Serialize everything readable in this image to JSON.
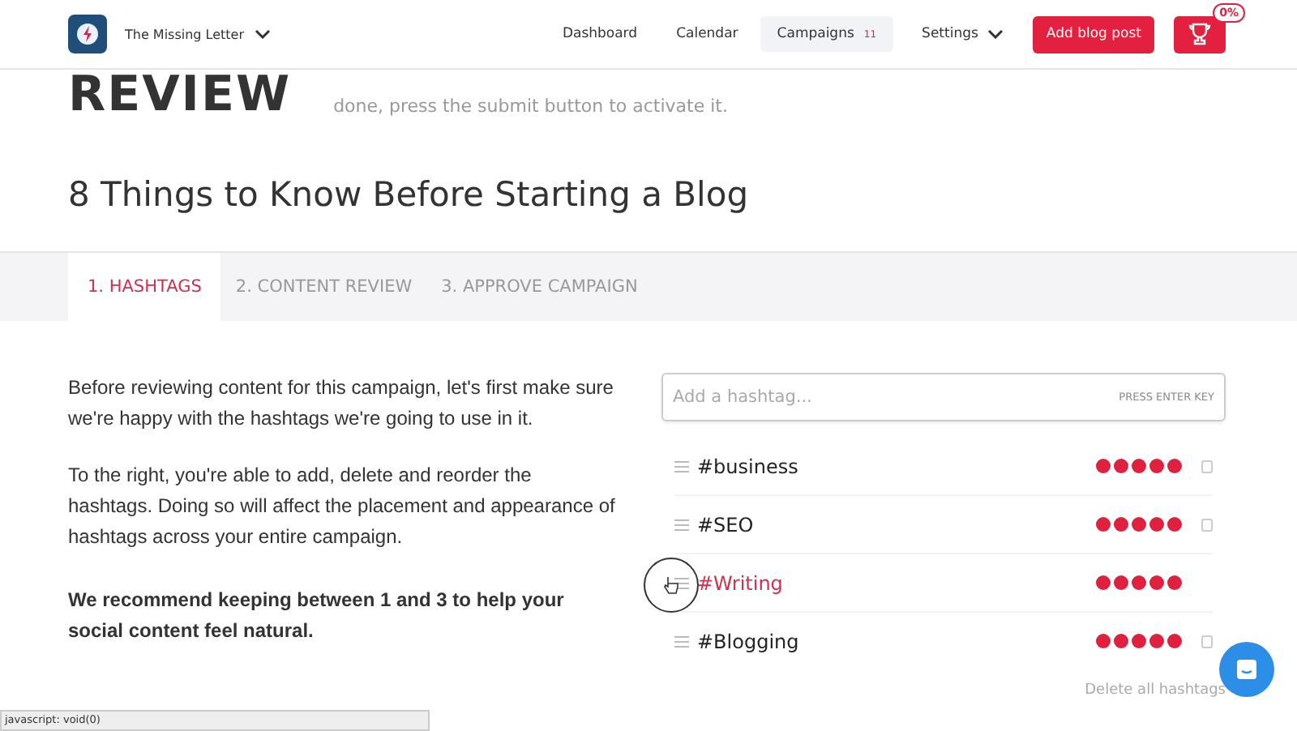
{
  "header": {
    "brand": "The Missing Letter",
    "nav": [
      {
        "label": "Dashboard",
        "selected": false
      },
      {
        "label": "Calendar",
        "selected": false
      },
      {
        "label": "Campaigns",
        "selected": true,
        "badge": "11"
      }
    ],
    "settings": "Settings",
    "add_button": "Add blog post",
    "progress_badge": "0%"
  },
  "page": {
    "heading": "REVIEW",
    "intro": "done, press the submit button to activate it.",
    "title": "8 Things to Know Before Starting a Blog"
  },
  "tabs": [
    {
      "label": "1. HASHTAGS",
      "selected": true
    },
    {
      "label": "2. CONTENT REVIEW",
      "selected": false
    },
    {
      "label": "3. APPROVE CAMPAIGN",
      "selected": false
    }
  ],
  "paragraphs": [
    {
      "text": "Before reviewing content for this campaign, let's first make sure we're happy with the hashtags we're going to use in it.",
      "bold": false
    },
    {
      "text": "To the right, you're able to add, delete and reorder the hashtags. Doing so will affect the placement and appearance of hashtags across your entire campaign.",
      "bold": false
    },
    {
      "text": "We recommend keeping between 1 and 3 to help your social content feel natural.",
      "bold": true
    }
  ],
  "hashtag_input": {
    "placeholder": "Add a hashtag...",
    "hint": "PRESS ENTER KEY"
  },
  "hashtags": [
    {
      "tag": "#business",
      "stars": 5,
      "hovered": false
    },
    {
      "tag": "#SEO",
      "stars": 5,
      "hovered": false
    },
    {
      "tag": "#Writing",
      "stars": 5,
      "hovered": true
    },
    {
      "tag": "#Blogging",
      "stars": 5,
      "hovered": false
    }
  ],
  "delete_all": "Delete all hashtags",
  "status_bar": "javascript: void(0)"
}
